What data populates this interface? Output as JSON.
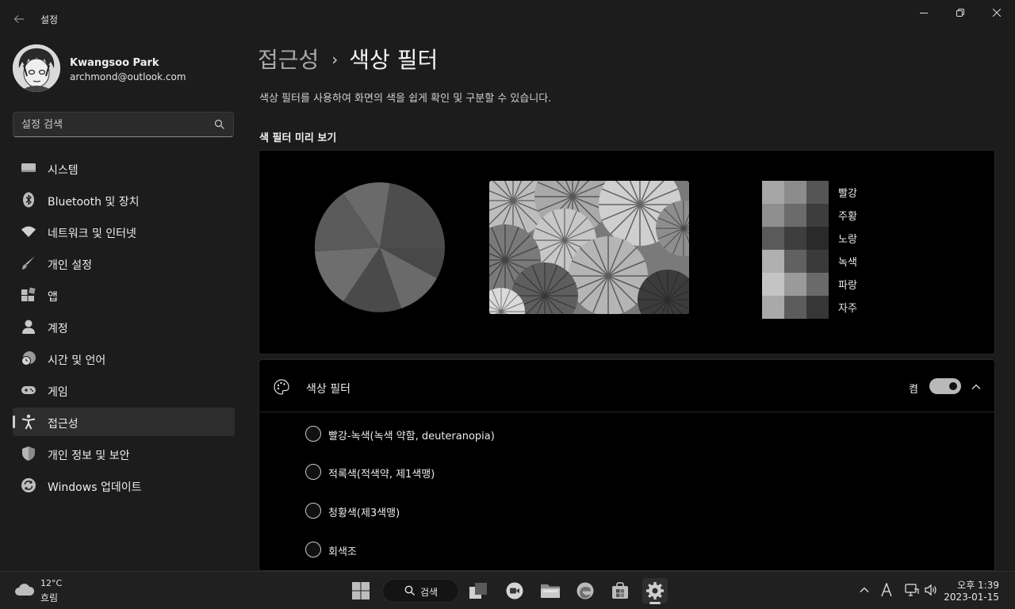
{
  "window": {
    "app_title": "설정"
  },
  "profile": {
    "name": "Kwangsoo Park",
    "email": "archmond@outlook.com"
  },
  "search": {
    "placeholder": "설정 검색"
  },
  "sidebar": {
    "items": [
      {
        "label": "시스템",
        "icon": "system-icon"
      },
      {
        "label": "Bluetooth 및 장치",
        "icon": "bluetooth-icon"
      },
      {
        "label": "네트워크 및 인터넷",
        "icon": "wifi-icon"
      },
      {
        "label": "개인 설정",
        "icon": "brush-icon"
      },
      {
        "label": "앱",
        "icon": "apps-icon"
      },
      {
        "label": "계정",
        "icon": "person-icon"
      },
      {
        "label": "시간 및 언어",
        "icon": "clock-globe-icon"
      },
      {
        "label": "게임",
        "icon": "gamepad-icon"
      },
      {
        "label": "접근성",
        "icon": "accessibility-icon",
        "selected": true
      },
      {
        "label": "개인 정보 및 보안",
        "icon": "shield-icon"
      },
      {
        "label": "Windows 업데이트",
        "icon": "update-icon"
      }
    ]
  },
  "main": {
    "breadcrumb_parent": "접근성",
    "breadcrumb_separator": "›",
    "breadcrumb_current": "색상 필터",
    "description": "색상 필터를 사용하여 화면의 색을 쉽게 확인 및 구분할 수 있습니다.",
    "preview_title": "색 필터 미리 보기",
    "swatch_labels": [
      "빨강",
      "주황",
      "노랑",
      "녹색",
      "파랑",
      "자주"
    ],
    "swatch_colors": [
      [
        "#a6a6a6",
        "#8c8c8c",
        "#555555"
      ],
      [
        "#8f8f8f",
        "#6b6b6b",
        "#3d3d3d"
      ],
      [
        "#5a5a5a",
        "#3e3e3e",
        "#2a2a2a"
      ],
      [
        "#b0b0b0",
        "#616161",
        "#3a3a3a"
      ],
      [
        "#c4c4c4",
        "#9a9a9a",
        "#6a6a6a"
      ],
      [
        "#a9a9a9",
        "#5c5c5c",
        "#363636"
      ]
    ],
    "color_filter": {
      "title": "색상 필터",
      "toggle_state_label": "켬",
      "toggle_on": true,
      "options": [
        "빨강-녹색(녹색 약함, deuteranopia)",
        "적록색(적색약, 제1색맹)",
        "청황색(제3색맹)",
        "회색조"
      ]
    }
  },
  "taskbar": {
    "weather_temp": "12°C",
    "weather_desc": "흐림",
    "search_label": "검색",
    "time": "오후 1:39",
    "date": "2023-01-15"
  }
}
